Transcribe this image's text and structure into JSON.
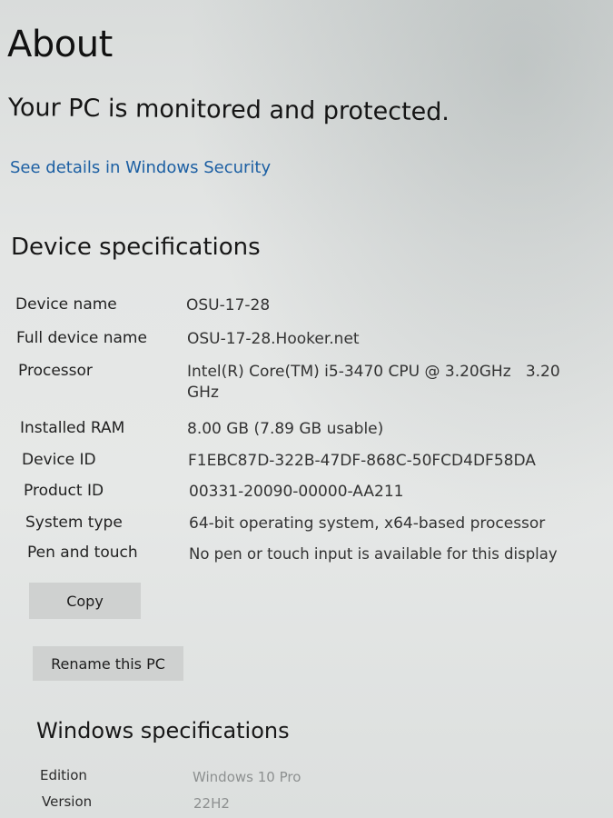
{
  "page": {
    "title": "About",
    "status_heading": "Your PC is monitored and protected.",
    "security_link": "See details in Windows Security"
  },
  "device_specs": {
    "heading": "Device specifications",
    "rows": [
      {
        "label": "Device name",
        "value": "OSU-17-28"
      },
      {
        "label": "Full device name",
        "value": "OSU-17-28.Hooker.net"
      },
      {
        "label": "Processor",
        "value": "Intel(R) Core(TM) i5-3470 CPU @ 3.20GHz   3.20 GHz"
      },
      {
        "label": "Installed RAM",
        "value": "8.00 GB (7.89 GB usable)"
      },
      {
        "label": "Device ID",
        "value": "F1EBC87D-322B-47DF-868C-50FCD4DF58DA"
      },
      {
        "label": "Product ID",
        "value": "00331-20090-00000-AA211"
      },
      {
        "label": "System type",
        "value": "64-bit operating system, x64-based processor"
      },
      {
        "label": "Pen and touch",
        "value": "No pen or touch input is available for this display"
      }
    ],
    "copy_label": "Copy",
    "rename_label": "Rename this PC"
  },
  "windows_specs": {
    "heading": "Windows specifications",
    "rows": [
      {
        "label": "Edition",
        "value": "Windows 10 Pro"
      },
      {
        "label": "Version",
        "value": "22H2"
      }
    ]
  },
  "colors": {
    "link": "#1c5fa3",
    "button_bg": "#cfd1d0",
    "background": "#e4e6e5"
  }
}
